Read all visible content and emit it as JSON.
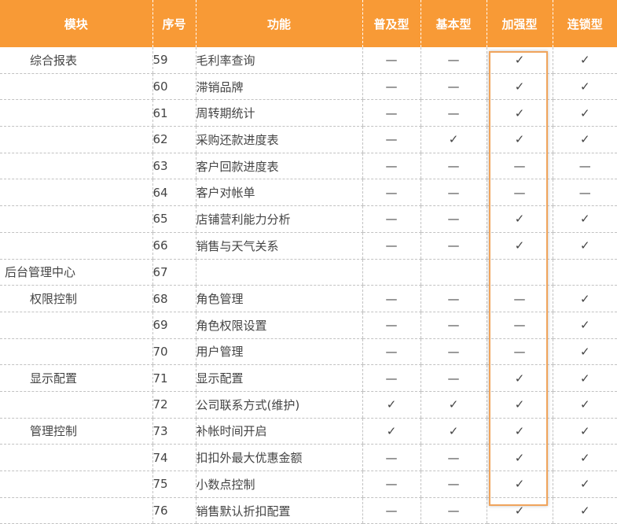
{
  "header": {
    "module": "模块",
    "no": "序号",
    "function": "功能",
    "basic_popular": "普及型",
    "basic": "基本型",
    "enhanced": "加强型",
    "chain": "连锁型"
  },
  "marks": {
    "yes": "✓",
    "no": "—"
  },
  "highlight_color": "#f0a45c",
  "header_color": "#f89a36",
  "rows": [
    {
      "module": "综合报表",
      "level": 1,
      "no": "59",
      "function": "毛利率查询",
      "v": [
        "no",
        "no",
        "yes",
        "yes"
      ]
    },
    {
      "module": "",
      "level": 1,
      "no": "60",
      "function": "滞销品牌",
      "v": [
        "no",
        "no",
        "yes",
        "yes"
      ]
    },
    {
      "module": "",
      "level": 1,
      "no": "61",
      "function": "周转期统计",
      "v": [
        "no",
        "no",
        "yes",
        "yes"
      ]
    },
    {
      "module": "",
      "level": 1,
      "no": "62",
      "function": "采购还款进度表",
      "v": [
        "no",
        "yes",
        "yes",
        "yes"
      ]
    },
    {
      "module": "",
      "level": 1,
      "no": "63",
      "function": "客户回款进度表",
      "v": [
        "no",
        "no",
        "no",
        "no"
      ]
    },
    {
      "module": "",
      "level": 1,
      "no": "64",
      "function": "客户对帐单",
      "v": [
        "no",
        "no",
        "no",
        "no"
      ]
    },
    {
      "module": "",
      "level": 1,
      "no": "65",
      "function": "店铺营利能力分析",
      "v": [
        "no",
        "no",
        "yes",
        "yes"
      ]
    },
    {
      "module": "",
      "level": 1,
      "no": "66",
      "function": "销售与天气关系",
      "v": [
        "no",
        "no",
        "yes",
        "yes"
      ]
    },
    {
      "module": "后台管理中心",
      "level": 0,
      "no": "67",
      "function": "",
      "v": [
        "",
        "",
        "",
        ""
      ]
    },
    {
      "module": "权限控制",
      "level": 1,
      "no": "68",
      "function": "角色管理",
      "v": [
        "no",
        "no",
        "no",
        "yes"
      ]
    },
    {
      "module": "",
      "level": 1,
      "no": "69",
      "function": "角色权限设置",
      "v": [
        "no",
        "no",
        "no",
        "yes"
      ]
    },
    {
      "module": "",
      "level": 1,
      "no": "70",
      "function": "用户管理",
      "v": [
        "no",
        "no",
        "no",
        "yes"
      ]
    },
    {
      "module": "显示配置",
      "level": 1,
      "no": "71",
      "function": "显示配置",
      "v": [
        "no",
        "no",
        "yes",
        "yes"
      ]
    },
    {
      "module": "",
      "level": 1,
      "no": "72",
      "function": "公司联系方式(维护)",
      "v": [
        "yes",
        "yes",
        "yes",
        "yes"
      ]
    },
    {
      "module": "管理控制",
      "level": 1,
      "no": "73",
      "function": "补帐时间开启",
      "v": [
        "yes",
        "yes",
        "yes",
        "yes"
      ]
    },
    {
      "module": "",
      "level": 1,
      "no": "74",
      "function": "扣扣外最大优惠金额",
      "v": [
        "no",
        "no",
        "yes",
        "yes"
      ]
    },
    {
      "module": "",
      "level": 1,
      "no": "75",
      "function": "小数点控制",
      "v": [
        "no",
        "no",
        "yes",
        "yes"
      ]
    },
    {
      "module": "",
      "level": 1,
      "no": "76",
      "function": "销售默认折扣配置",
      "v": [
        "no",
        "no",
        "yes",
        "yes"
      ]
    }
  ]
}
